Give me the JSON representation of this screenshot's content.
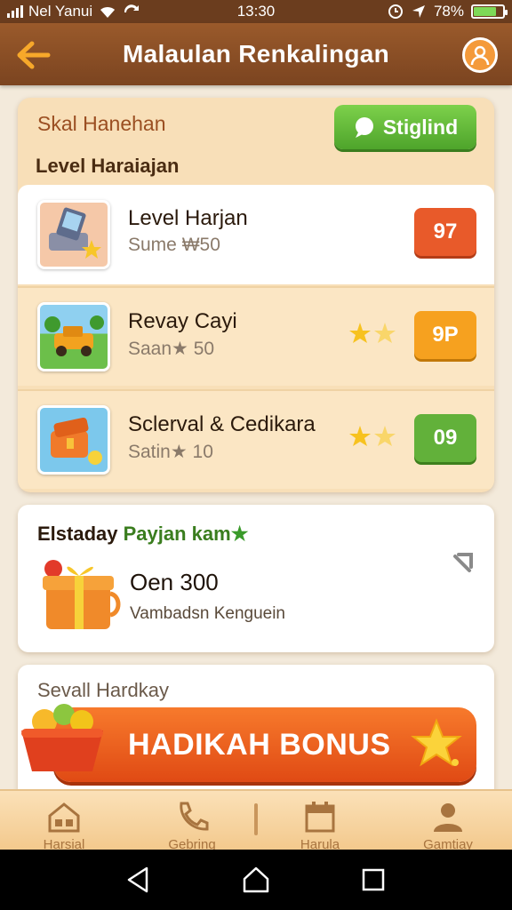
{
  "status_bar": {
    "carrier": "Nel Yanui",
    "time": "13:30",
    "battery": "78%",
    "battery_level": 0.78
  },
  "header": {
    "title": "Malaulan Renkalingan",
    "back_icon": "arrow-left-icon",
    "profile_icon": "user-icon"
  },
  "levels_panel": {
    "subtitle": "Skal Hanehan",
    "heading": "Level Haraiajan",
    "action_button": "Stiglind",
    "levels": [
      {
        "name": "Level Harjan",
        "sub": "Sume ₩50",
        "badge": "97",
        "badge_color": "#e85a2a",
        "stars": 0
      },
      {
        "name": "Revay Cayi",
        "sub": "Saan★ 50",
        "badge": "9P",
        "badge_color": "#f6a11f",
        "stars": 2
      },
      {
        "name": "Sclerval & Cedikara",
        "sub": "Satin★ 10",
        "badge": "09",
        "badge_color": "#62b13a",
        "stars": 2
      }
    ]
  },
  "reward": {
    "title_main": "Elstaday ",
    "title_highlight": "Payjan kam",
    "amount": "Oen 300",
    "description": "Vambadsn Kenguein",
    "gift_icon": "gift-icon",
    "arrow_icon": "arrow-icon"
  },
  "bonus": {
    "title": "Sevall Hardkay",
    "button_label": "HADIKAH BONUS",
    "star_icon": "star-icon",
    "basket_icon": "fruit-basket-icon"
  },
  "bottom_nav": {
    "items": [
      {
        "label": "Harsial",
        "icon": "home-icon"
      },
      {
        "label": "Gebring",
        "icon": "phone-icon"
      },
      {
        "label": "Harula",
        "icon": "calendar-icon"
      },
      {
        "label": "Gamtiay",
        "icon": "person-icon"
      }
    ]
  },
  "colors": {
    "header": "#8a4c24",
    "accent_orange": "#f6a11f",
    "accent_green": "#62b13a",
    "accent_red": "#e85a2a"
  }
}
